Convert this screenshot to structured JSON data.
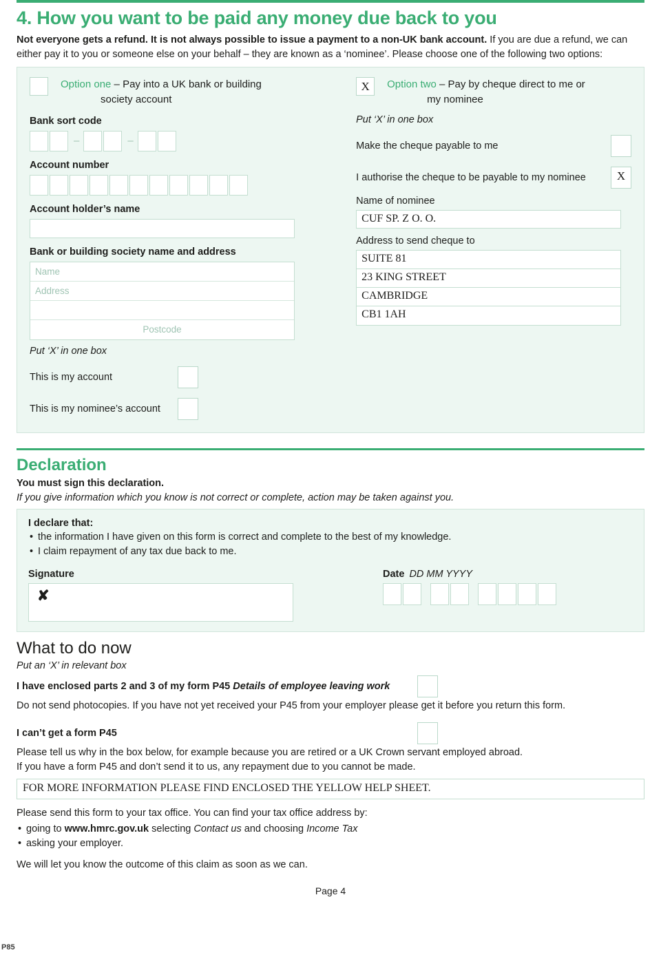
{
  "form_code": "P85",
  "page_number": "Page 4",
  "accent_color": "#3aad73",
  "panel_bg": "#edf7f2",
  "section4": {
    "heading": "4. How you want to be paid any money due back to you",
    "intro_bold": "Not everyone gets a refund. It is not always possible to issue a payment to a non-UK bank account.",
    "intro_rest": " If you are due a refund, we can either pay it to you or someone else on your behalf – they are known as a ‘nominee’. Please choose one of the following two options:",
    "option_one": {
      "checkbox_value": "",
      "name": "Option one",
      "desc_line1": " – Pay into a UK bank or building",
      "desc_line2": "society account",
      "sort_code_label": "Bank sort code",
      "sort_code_boxes": [
        "",
        "",
        "",
        "",
        "",
        ""
      ],
      "sort_code_separator": "–",
      "account_number_label": "Account number",
      "account_number_boxes": [
        "",
        "",
        "",
        "",
        "",
        "",
        "",
        "",
        "",
        "",
        ""
      ],
      "account_holder_label": "Account holder’s name",
      "account_holder_value": "",
      "bank_address_label": "Bank or building society name and address",
      "bank_name_placeholder": "Name",
      "bank_address_placeholder": "Address",
      "bank_address_line2": "",
      "bank_postcode_placeholder": "Postcode",
      "put_x_note": "Put ‘X’ in one box",
      "my_account_label": "This is my account",
      "my_account_value": "",
      "nominee_account_label": "This is my nominee’s account",
      "nominee_account_value": ""
    },
    "option_two": {
      "checkbox_value": "X",
      "name": "Option two",
      "desc_line1": " – Pay by cheque direct to me or",
      "desc_line2": "my nominee",
      "put_x_note": "Put ‘X’ in one box",
      "payable_to_me_label": "Make the cheque payable to me",
      "payable_to_me_value": "",
      "payable_to_nominee_label": "I authorise the cheque to be payable to my nominee",
      "payable_to_nominee_value": "X",
      "nominee_name_label": "Name of nominee",
      "nominee_name_value": "CUF SP. Z O. O.",
      "cheque_address_label": "Address to send cheque to",
      "cheque_address_lines": [
        "SUITE 81",
        "23 KING STREET",
        "CAMBRIDGE",
        "CB1 1AH"
      ]
    }
  },
  "declaration": {
    "heading": "Declaration",
    "must_sign": "You must sign this declaration.",
    "warning": "If you give information which you know is not correct or complete, action may be taken against you.",
    "declare_lead": "I declare that:",
    "bullets": [
      "the information I have given on this form is correct and complete to the best of my knowledge.",
      "I claim repayment of any tax due back to me."
    ],
    "signature_label": "Signature",
    "signature_value": "✘",
    "date_label": "Date",
    "date_format": "DD MM YYYY",
    "date_boxes": [
      "",
      "",
      "",
      "",
      "",
      "",
      "",
      ""
    ]
  },
  "what_to_do": {
    "heading": "What to do now",
    "put_x_note": "Put an ‘X’ in relevant box",
    "p45_enclosed_bold": "I have enclosed parts 2 and 3 of my form P45 ",
    "p45_enclosed_italic": "Details of employee leaving work",
    "p45_enclosed_value": "",
    "p45_note": "Do not send photocopies. If you have not yet received your P45 from your employer please get it before you return this form.",
    "cant_get_heading": "I can’t get a form P45",
    "cant_get_value": "",
    "cant_get_line1": "Please tell us why in the box below, for example because you are retired or a UK Crown servant employed abroad.",
    "cant_get_line2": "If you have a form P45 and don’t send it to us, any repayment due to you cannot be made.",
    "reason_value": "FOR MORE INFORMATION PLEASE FIND ENCLOSED THE YELLOW HELP SHEET.",
    "send_intro": "Please send this form to your tax office. You can find your tax office address by:",
    "bullet1_a": "going to ",
    "bullet1_url": "www.hmrc.gov.uk",
    "bullet1_b": " selecting ",
    "bullet1_c": "Contact us",
    "bullet1_d": " and choosing ",
    "bullet1_e": "Income Tax",
    "bullet2": "asking your employer.",
    "outcome": "We will let you know the outcome of this claim as soon as we can."
  }
}
